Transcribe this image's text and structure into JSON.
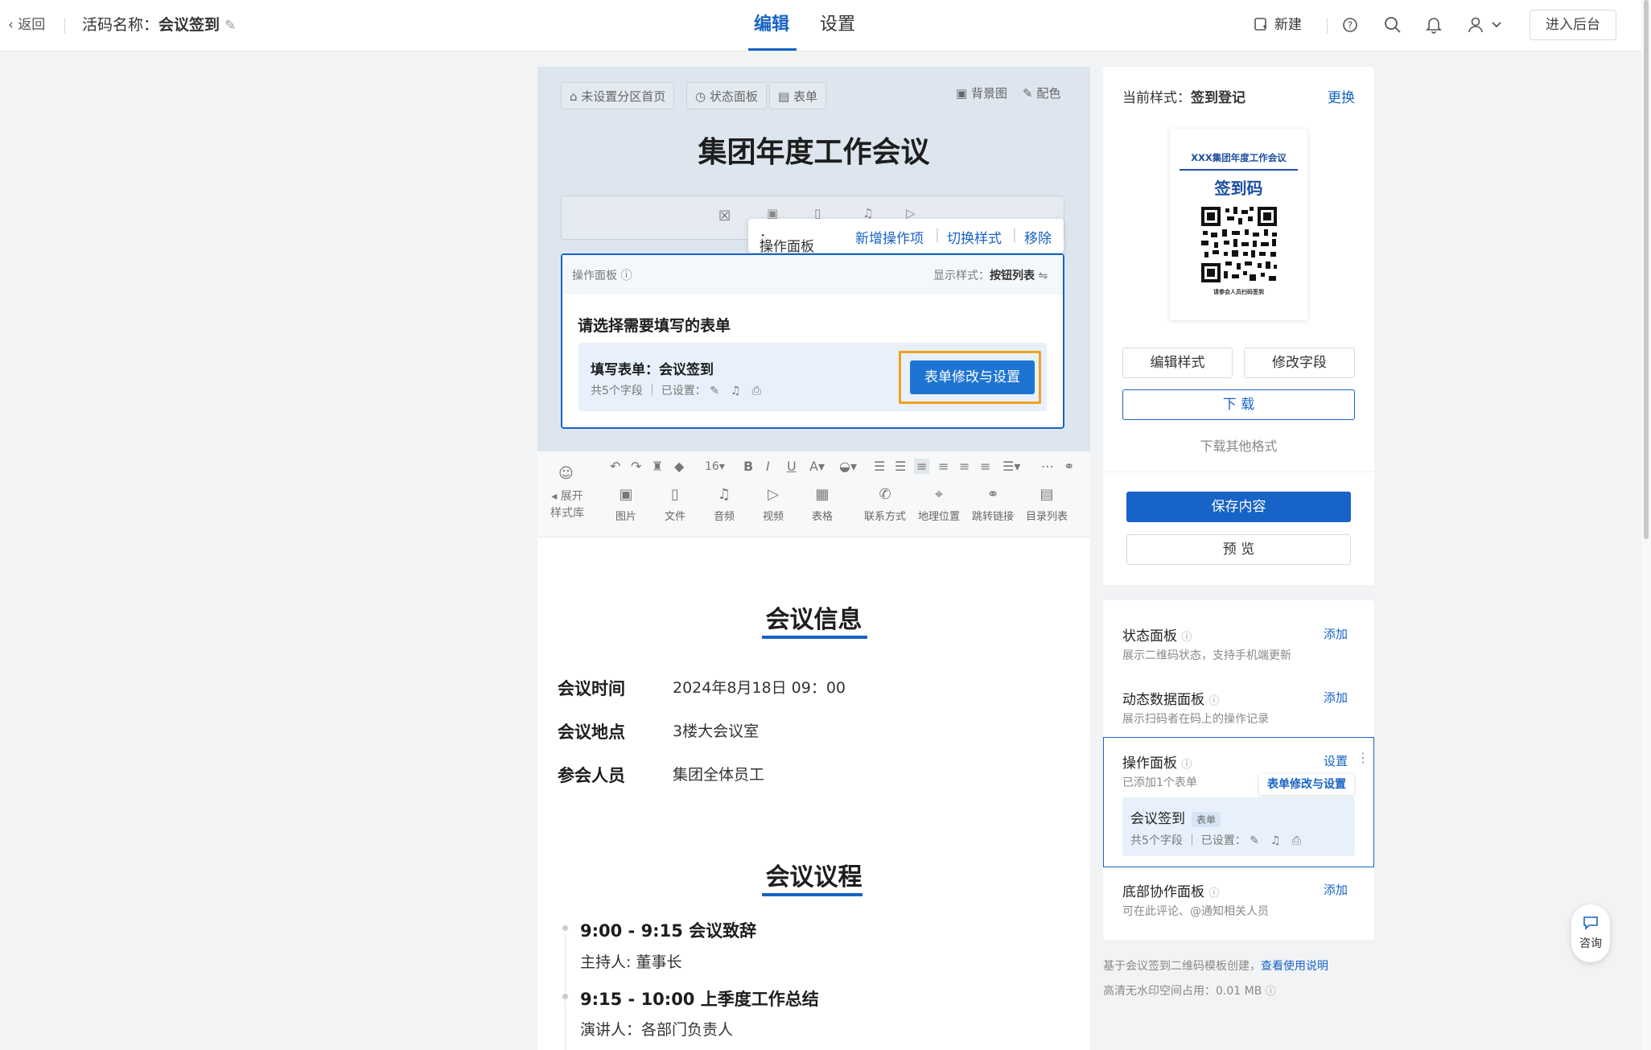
{
  "topbar": {
    "back": "返回",
    "activity_label": "活码名称：",
    "activity_name": "会议签到",
    "tab_edit": "编辑",
    "tab_settings": "设置",
    "new_label": "新建",
    "backend_label": "进入后台"
  },
  "editor": {
    "chip_home": "未设置分区首页",
    "chip_status": "状态面板",
    "chip_form": "表单",
    "bg_image": "背景图",
    "color_scheme": "配色",
    "event_title": "集团年度工作会议",
    "floatbar": {
      "label": "操作面板",
      "add": "新增操作项",
      "switch": "切换样式",
      "remove": "移除"
    },
    "op_panel": {
      "title": "操作面板",
      "display_label": "显示样式：",
      "display_value": "按钮列表",
      "prompt": "请选择需要填写的表单",
      "form_title": "填写表单：会议签到",
      "form_meta": "共5个字段 ｜ 已设置：",
      "form_button": "表单修改与设置"
    }
  },
  "toolbar": {
    "font_size": "16",
    "expand": "展开",
    "style_lib": "样式库",
    "items": [
      "图片",
      "文件",
      "音频",
      "视频",
      "表格",
      "联系方式",
      "地理位置",
      "跳转链接",
      "目录列表"
    ]
  },
  "content": {
    "section1": "会议信息",
    "rows": [
      {
        "label": "会议时间",
        "value": "2024年8月18日 09：00"
      },
      {
        "label": "会议地点",
        "value": "3楼大会议室"
      },
      {
        "label": "参会人员",
        "value": "集团全体员工"
      }
    ],
    "section2": "会议议程",
    "agenda": [
      {
        "title": "9:00 - 9:15 会议致辞",
        "sub": "主持人: 董事长"
      },
      {
        "title": "9:15 - 10:00 上季度工作总结",
        "sub": "演讲人：各部门负责人"
      }
    ]
  },
  "right": {
    "current_style_label": "当前样式：",
    "current_style_value": "签到登记",
    "change": "更换",
    "qr_heading": "XXX集团年度工作会议",
    "qr_title": "签到码",
    "qr_caption": "请参会人员扫码签到",
    "edit_style": "编辑样式",
    "edit_fields": "修改字段",
    "download": "下 载",
    "download_other": "下载其他格式",
    "save": "保存内容",
    "preview": "预 览",
    "panels": [
      {
        "title": "状态面板",
        "desc": "展示二维码状态，支持手机端更新",
        "action": "添加"
      },
      {
        "title": "动态数据面板",
        "desc": "展示扫码者在码上的操作记录",
        "action": "添加"
      }
    ],
    "op_panel": {
      "title": "操作面板",
      "desc": "已添加1个表单",
      "action": "设置",
      "tooltip": "表单修改与设置",
      "form_name": "会议签到",
      "form_tag": "表单",
      "form_meta": "共5个字段 ｜ 已设置："
    },
    "bottom_panel": {
      "title": "底部协作面板",
      "desc": "可在此评论、@通知相关人员",
      "action": "添加"
    },
    "footer1_prefix": "基于会议签到二维码模板创建，",
    "footer1_link": "查看使用说明",
    "footer2": "高清无水印空间占用：0.01 MB"
  },
  "consult": "咨询",
  "colors": {
    "primary": "#1763c7",
    "highlight": "#f0a020"
  }
}
